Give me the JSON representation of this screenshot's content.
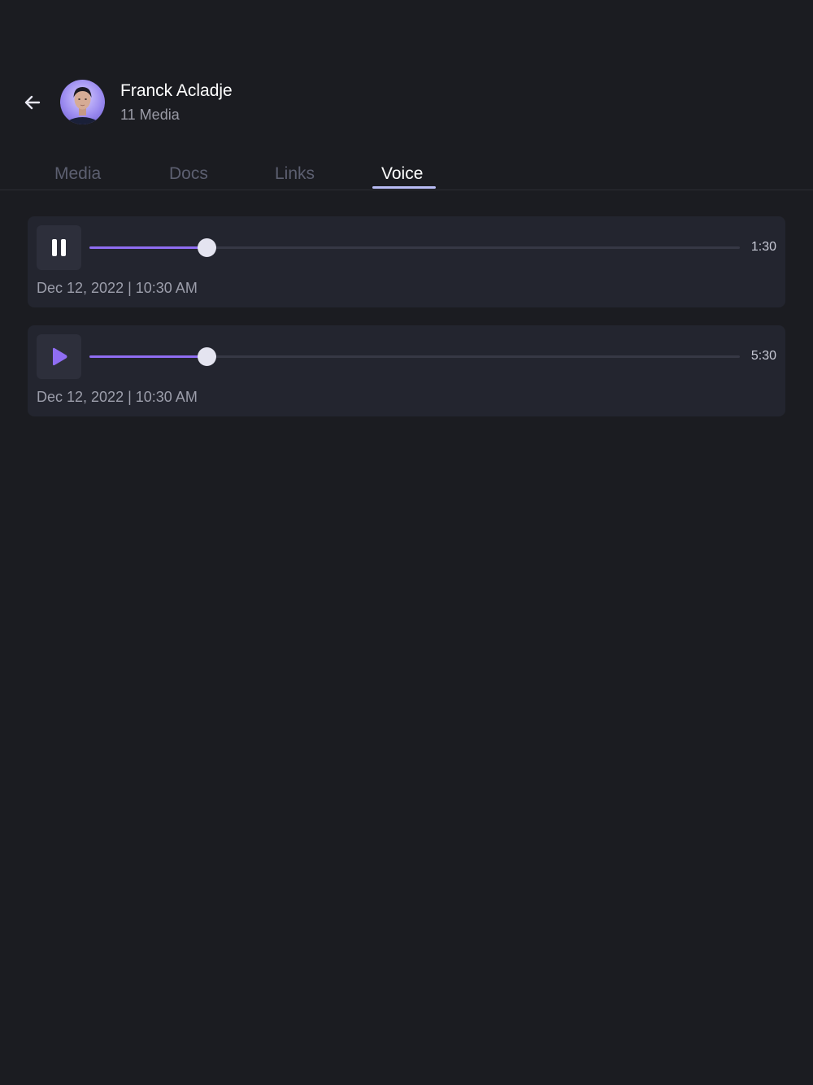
{
  "header": {
    "name": "Franck Acladje",
    "subtitle": "11 Media",
    "back_icon": "arrow-left-icon"
  },
  "tabs": [
    {
      "label": "Media",
      "active": false
    },
    {
      "label": "Docs",
      "active": false
    },
    {
      "label": "Links",
      "active": false
    },
    {
      "label": "Voice",
      "active": true
    }
  ],
  "voice_messages": [
    {
      "state": "playing",
      "control_icon": "pause-icon",
      "progress": 0.18,
      "duration": "1:30",
      "timestamp": "Dec 12, 2022 | 10:30 AM"
    },
    {
      "state": "paused",
      "control_icon": "play-icon",
      "progress": 0.18,
      "duration": "5:30",
      "timestamp": "Dec 12, 2022 | 10:30 AM"
    }
  ],
  "colors": {
    "background": "#1b1c21",
    "card": "#23252f",
    "accent": "#8f6df2",
    "tab_underline": "#b9bcf5"
  }
}
